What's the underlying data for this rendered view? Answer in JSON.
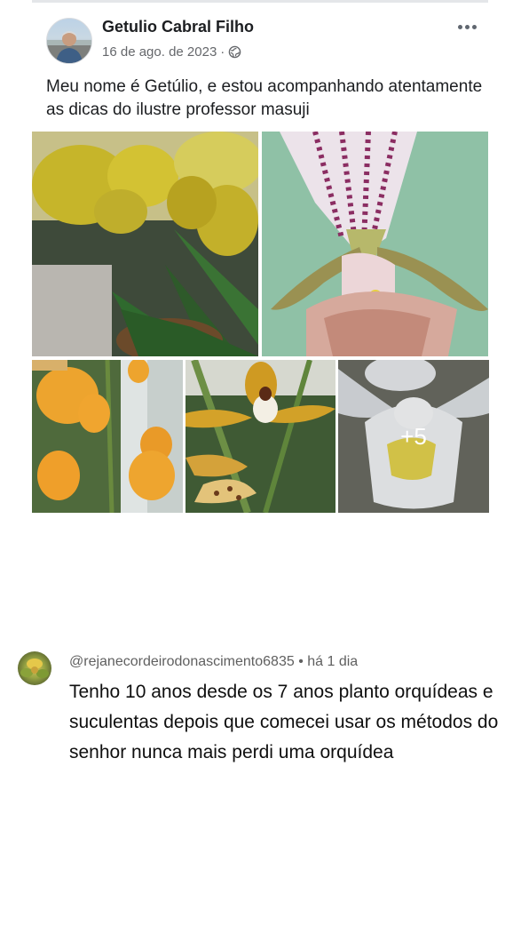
{
  "post": {
    "author": "Getulio Cabral Filho",
    "date": "16 de ago. de 2023",
    "separator": "·",
    "privacy_icon": "globe-icon",
    "more_icon": "more-options-icon",
    "text": "Meu nome é Getúlio, e estou acompanhando atentamente as dicas do ilustre professor masuji",
    "photos": [
      {
        "subject": "yellow-slipper-orchid"
      },
      {
        "subject": "paphiopedilum-closeup"
      },
      {
        "subject": "orange-orchid-cluster"
      },
      {
        "subject": "yellow-brown-spotted-orchid"
      },
      {
        "subject": "white-orchid",
        "overlay": "+5"
      }
    ]
  },
  "comment": {
    "handle": "@rejanecordeirodonascimento6835",
    "separator": "•",
    "time": "há 1 dia",
    "text": "Tenho 10 anos desde os 7 anos planto orquídeas e suculentas depois que comecei usar os métodos do senhor nunca mais perdi uma orquídea"
  },
  "colors": {
    "author_text": "#1c1e21",
    "meta_text": "#65676b",
    "comment_meta": "#606060"
  }
}
